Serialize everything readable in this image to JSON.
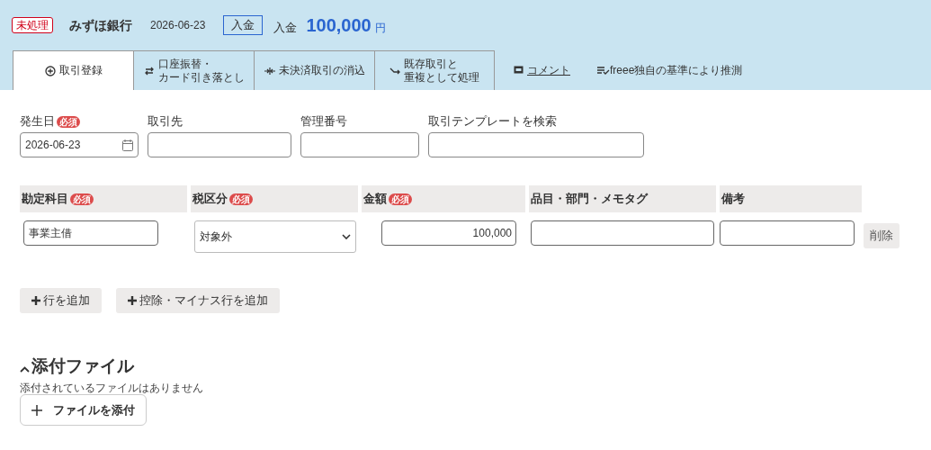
{
  "header": {
    "status": "未処理",
    "bank": "みずほ銀行",
    "date": "2026-06-23",
    "type_tag": "入金",
    "type_label": "入金",
    "amount": "100,000",
    "currency": "円"
  },
  "tabs": [
    {
      "kind": "register",
      "lines": [
        "取引登録"
      ],
      "selected": true
    },
    {
      "kind": "transfer",
      "lines": [
        "口座振替・",
        "カード引き落とし"
      ],
      "selected": false
    },
    {
      "kind": "clear",
      "lines": [
        "未決済取引の消込"
      ],
      "selected": false
    },
    {
      "kind": "duplicate",
      "lines": [
        "既存取引と",
        "重複として処理"
      ],
      "selected": false
    }
  ],
  "comment_link": "コメント",
  "estimate_note": "freee独自の基準により推測",
  "fields": [
    {
      "kind": "date",
      "label": "発生日",
      "badge": "必須",
      "value": "2026-06-23"
    },
    {
      "kind": "text",
      "label": "取引先"
    },
    {
      "kind": "text",
      "label": "管理番号"
    },
    {
      "kind": "text",
      "label": "取引テンプレートを検索"
    }
  ],
  "table": {
    "columns": [
      {
        "label": "勘定科目",
        "badge": "必須"
      },
      {
        "label": "税区分",
        "badge": "必須"
      },
      {
        "label": "金額",
        "badge": "必須"
      },
      {
        "label": "品目・部門・メモタグ"
      },
      {
        "label": "備考"
      }
    ],
    "rows": [
      {
        "account": "事業主借",
        "tax": "対象外",
        "amount": "100,000",
        "delete": "削除"
      }
    ]
  },
  "add_buttons": [
    "行を追加",
    "控除・マイナス行を追加"
  ],
  "attachments": {
    "title": "添付ファイル",
    "expanded": true,
    "empty_note": "添付されているファイルはありません",
    "add_button": "ファイルを添付"
  }
}
